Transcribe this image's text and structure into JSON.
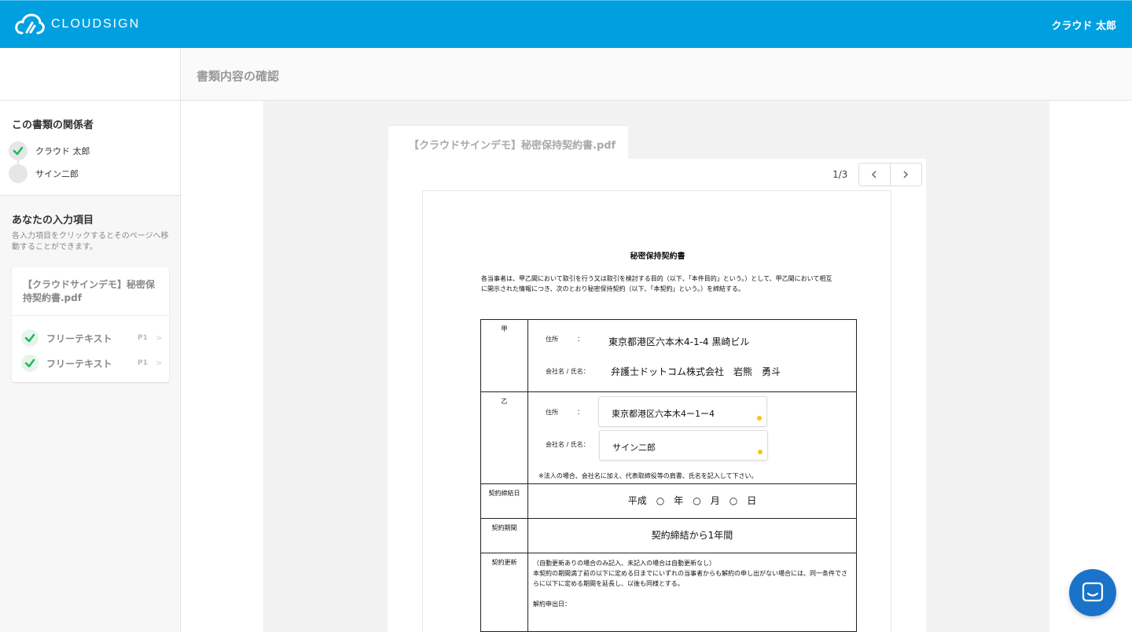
{
  "app": {
    "logo_text": "CLOUDSIGN",
    "user_name": "クラウド 太郎"
  },
  "subheader": {
    "title": "書類内容の確認"
  },
  "sidebar": {
    "parties_title": "この書類の関係者",
    "parties": [
      {
        "name": "クラウド 太郎",
        "status": "done"
      },
      {
        "name": "サイン二郎",
        "status": "pending"
      }
    ],
    "inputs_title": "あなたの入力項目",
    "inputs_desc": "各入力項目をクリックするとそのページへ移動することができます。",
    "doc_name": "【クラウドサインデモ】秘密保持契約書.pdf",
    "fields": [
      {
        "label": "フリーテキスト",
        "page": "P1",
        "arrow": ">"
      },
      {
        "label": "フリーテキスト",
        "page": "P1",
        "arrow": ">"
      }
    ]
  },
  "viewer": {
    "tab_label": "【クラウドサインデモ】秘密保持契約書.pdf",
    "page_indicator": "1/3"
  },
  "document": {
    "title": "秘密保持契約書",
    "intro": "各当事者は、甲乙間において取引を行う又は取引を検討する目的（以下、「本件目的」という。）として、甲乙間において相互に開示された情報につき、次のとおり秘密保持契約（以下、「本契約」という。）を締結する。",
    "party_a": {
      "label": "甲",
      "address_label": "住所　　　：",
      "address": "東京都港区六本木4-1-4 黒崎ビル",
      "name_label": "会社名 / 氏名：",
      "name": "弁護士ドットコム株式会社　岩熊　勇斗"
    },
    "party_b": {
      "label": "乙",
      "address_label": "住所　　　：",
      "address_value": "東京都港区六本木4ー1ー4",
      "name_label": "会社名 / 氏名：",
      "name_value": "サイン二郎",
      "note": "※法人の場合、会社名に加え、代表取締役等の肩書、氏名を記入して下さい。"
    },
    "date_row": {
      "label": "契約締結日",
      "value": "平成　○　年　○　月　○　日"
    },
    "term_row": {
      "label": "契約期間",
      "value": "契約締結から1年間"
    },
    "renew_row": {
      "label": "契約更新",
      "line1": "（自動更新ありの場合のみ記入、未記入の場合は自動更新なし）",
      "line2": "本契約の期間満了前の以下に定める日までにいずれの当事者からも解約の申し出がない場合には、同一条件でさらに以下に定める期間を延長し、以後も同様とする。",
      "line3": "解約申出日："
    }
  },
  "colors": {
    "brand": "#00a0e0",
    "check": "#1db954",
    "chat": "#1a73c9",
    "marker": "#f5c518"
  }
}
